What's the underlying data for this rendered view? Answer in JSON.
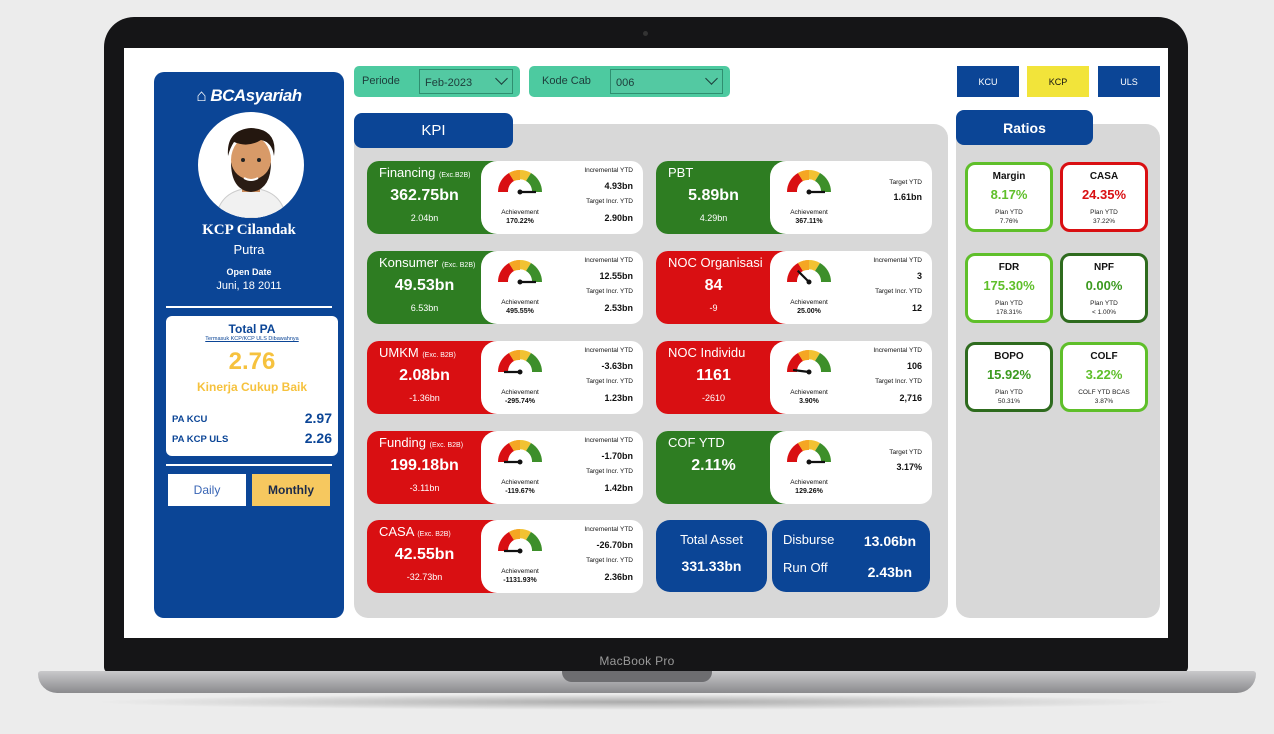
{
  "device": {
    "brand": "MacBook Pro"
  },
  "colors": {
    "blue": "#0b4596",
    "green": "#2e7d22",
    "red": "#d90f12",
    "teal": "#4dcaa0",
    "yellow": "#f6c23e"
  },
  "branch": {
    "logo": "BCAsyariah",
    "name": "KCP Cilandak",
    "type": "Putra",
    "open_label": "Open Date",
    "open_date": "Juni, 18 2011"
  },
  "pa": {
    "title": "Total PA",
    "note": "Termasuk KCP/KCP ULS Dibawahnya",
    "value": "2.76",
    "rating": "Kinerja Cukup Baik",
    "kcu_label": "PA KCU",
    "kcu_value": "2.97",
    "kcpuls_label": "PA KCP ULS",
    "kcpuls_value": "2.26"
  },
  "period_toggle": {
    "daily": "Daily",
    "monthly": "Monthly",
    "active": "Monthly"
  },
  "filters": {
    "periode_label": "Periode",
    "periode_value": "Feb-2023",
    "kode_label": "Kode Cab",
    "kode_value": "006"
  },
  "level_buttons": {
    "kcu": "KCU",
    "kcp": "KCP",
    "uls": "ULS",
    "active": "KCP"
  },
  "kpi": {
    "title": "KPI",
    "achievement_label": "Achievement",
    "inc_label": "Incremental YTD",
    "target_incr_label": "Target Incr. YTD",
    "target_ytd_label": "Target YTD",
    "cards": [
      {
        "title": "Financing",
        "tag": "(Exc.B2B)",
        "value": "362.75bn",
        "sub": "2.04bn",
        "color": "green",
        "achievement": "170.22%",
        "incremental": "4.93bn",
        "target": "2.90bn",
        "needle": 1.0
      },
      {
        "title": "PBT",
        "tag": "",
        "value": "5.89bn",
        "sub": "4.29bn",
        "color": "green",
        "achievement": "367.11%",
        "target": "1.61bn",
        "needle": 1.0
      },
      {
        "title": "Konsumer",
        "tag": "(Exc. B2B)",
        "value": "49.53bn",
        "sub": "6.53bn",
        "color": "green",
        "achievement": "495.55%",
        "incremental": "12.55bn",
        "target": "2.53bn",
        "needle": 1.0
      },
      {
        "title": "NOC Organisasi",
        "tag": "",
        "value": "84",
        "sub": "-9",
        "color": "red",
        "achievement": "25.00%",
        "incremental": "3",
        "target": "12",
        "needle": 0.25
      },
      {
        "title": "UMKM",
        "tag": "(Exc. B2B)",
        "value": "2.08bn",
        "sub": "-1.36bn",
        "color": "red",
        "achievement": "-295.74%",
        "incremental": "-3.63bn",
        "target": "1.23bn",
        "needle": 0.0
      },
      {
        "title": "NOC Individu",
        "tag": "",
        "value": "1161",
        "sub": "-2610",
        "color": "red",
        "achievement": "3.90%",
        "incremental": "106",
        "target": "2,716",
        "needle": 0.04
      },
      {
        "title": "Funding",
        "tag": "(Exc. B2B)",
        "value": "199.18bn",
        "sub": "-3.11bn",
        "color": "red",
        "achievement": "-119.67%",
        "incremental": "-1.70bn",
        "target": "1.42bn",
        "needle": 0.0
      },
      {
        "title": "COF YTD",
        "tag": "",
        "value": "2.11%",
        "sub": "",
        "color": "green",
        "achievement": "129.26%",
        "target": "3.17%",
        "needle": 1.0
      },
      {
        "title": "CASA",
        "tag": "(Exc. B2B)",
        "value": "42.55bn",
        "sub": "-32.73bn",
        "color": "red",
        "achievement": "-1131.93%",
        "incremental": "-26.70bn",
        "target": "2.36bn",
        "needle": 0.0
      }
    ],
    "total_asset_label": "Total Asset",
    "total_asset_value": "331.33bn",
    "disburse_label": "Disburse",
    "disburse_value": "13.06bn",
    "runoff_label": "Run Off",
    "runoff_value": "2.43bn"
  },
  "ratios": {
    "title": "Ratios",
    "items": [
      {
        "title": "Margin",
        "value": "8.17%",
        "plan_label": "Plan YTD",
        "plan_value": "7.76%",
        "status": "good"
      },
      {
        "title": "CASA",
        "value": "24.35%",
        "plan_label": "Plan YTD",
        "plan_value": "37.22%",
        "status": "bad"
      },
      {
        "title": "FDR",
        "value": "175.30%",
        "plan_label": "Plan YTD",
        "plan_value": "178.31%",
        "status": "good"
      },
      {
        "title": "NPF",
        "value": "0.00%",
        "plan_label": "Plan YTD",
        "plan_value": "< 1.00%",
        "status": "good-dark"
      },
      {
        "title": "BOPO",
        "value": "15.92%",
        "plan_label": "Plan YTD",
        "plan_value": "50.31%",
        "status": "good-dark"
      },
      {
        "title": "COLF",
        "value": "3.22%",
        "plan_label": "COLF YTD BCAS",
        "plan_value": "3.87%",
        "status": "good"
      }
    ]
  }
}
